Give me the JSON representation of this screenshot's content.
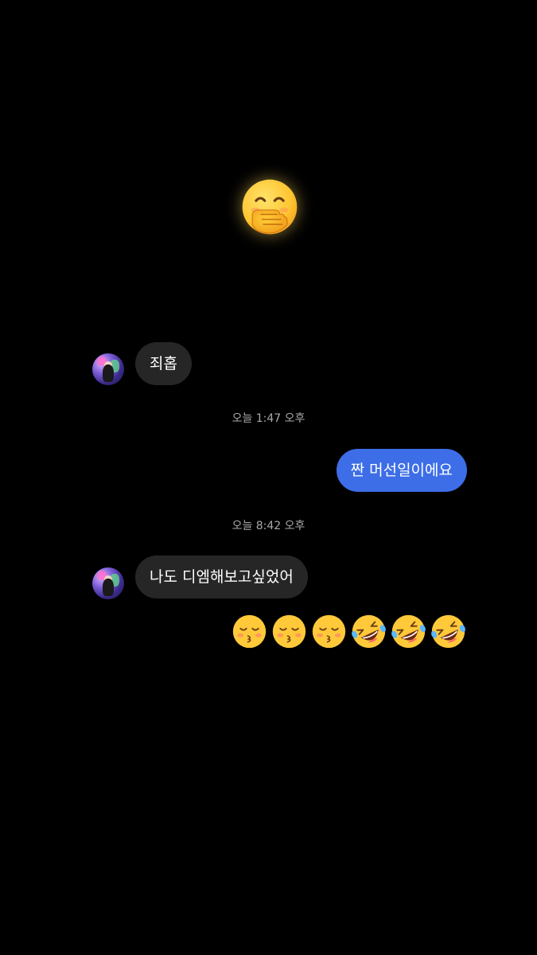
{
  "messages": {
    "big_emoji": "hand-over-mouth-emoji",
    "msg1_text": "죄홉",
    "ts1": "오늘 1:47 오후",
    "msg2_text": "짠 머선일이에요",
    "ts2": "오늘 8:42 오후",
    "msg3_text": "나도 디엠해보고싶었어",
    "emoji_row": [
      "kissing-closed-eyes-emoji",
      "kissing-closed-eyes-emoji",
      "kissing-closed-eyes-emoji",
      "rolling-laughing-emoji",
      "rolling-laughing-emoji",
      "rolling-laughing-emoji"
    ]
  },
  "colors": {
    "background": "#000000",
    "incoming_bubble": "#262626",
    "outgoing_bubble": "#3d6ee8",
    "timestamp_text": "#a8a8a8"
  }
}
